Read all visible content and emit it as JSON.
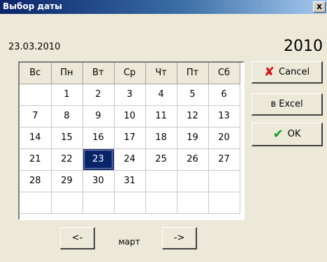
{
  "window": {
    "title": "Выбор даты",
    "close_label": "x"
  },
  "selected_date": "23.03.2010",
  "year": "2010",
  "calendar": {
    "weekdays": [
      "Вс",
      "Пн",
      "Вт",
      "Ср",
      "Чт",
      "Пт",
      "Сб"
    ],
    "weeks": [
      [
        "",
        "1",
        "2",
        "3",
        "4",
        "5",
        "6"
      ],
      [
        "7",
        "8",
        "9",
        "10",
        "11",
        "12",
        "13"
      ],
      [
        "14",
        "15",
        "16",
        "17",
        "18",
        "19",
        "20"
      ],
      [
        "21",
        "22",
        "23",
        "24",
        "25",
        "26",
        "27"
      ],
      [
        "28",
        "29",
        "30",
        "31",
        "",
        "",
        ""
      ],
      [
        "",
        "",
        "",
        "",
        "",
        "",
        ""
      ]
    ],
    "selected_day": "23"
  },
  "buttons": {
    "cancel": "Cancel",
    "excel": "в Excel",
    "ok": "OK",
    "prev": "<-",
    "next": "->"
  },
  "month": "март",
  "colors": {
    "titlebar": "#0a246a",
    "selection": "#0a246a",
    "cancel_icon": "#d81010",
    "ok_icon": "#1a9a1a"
  }
}
